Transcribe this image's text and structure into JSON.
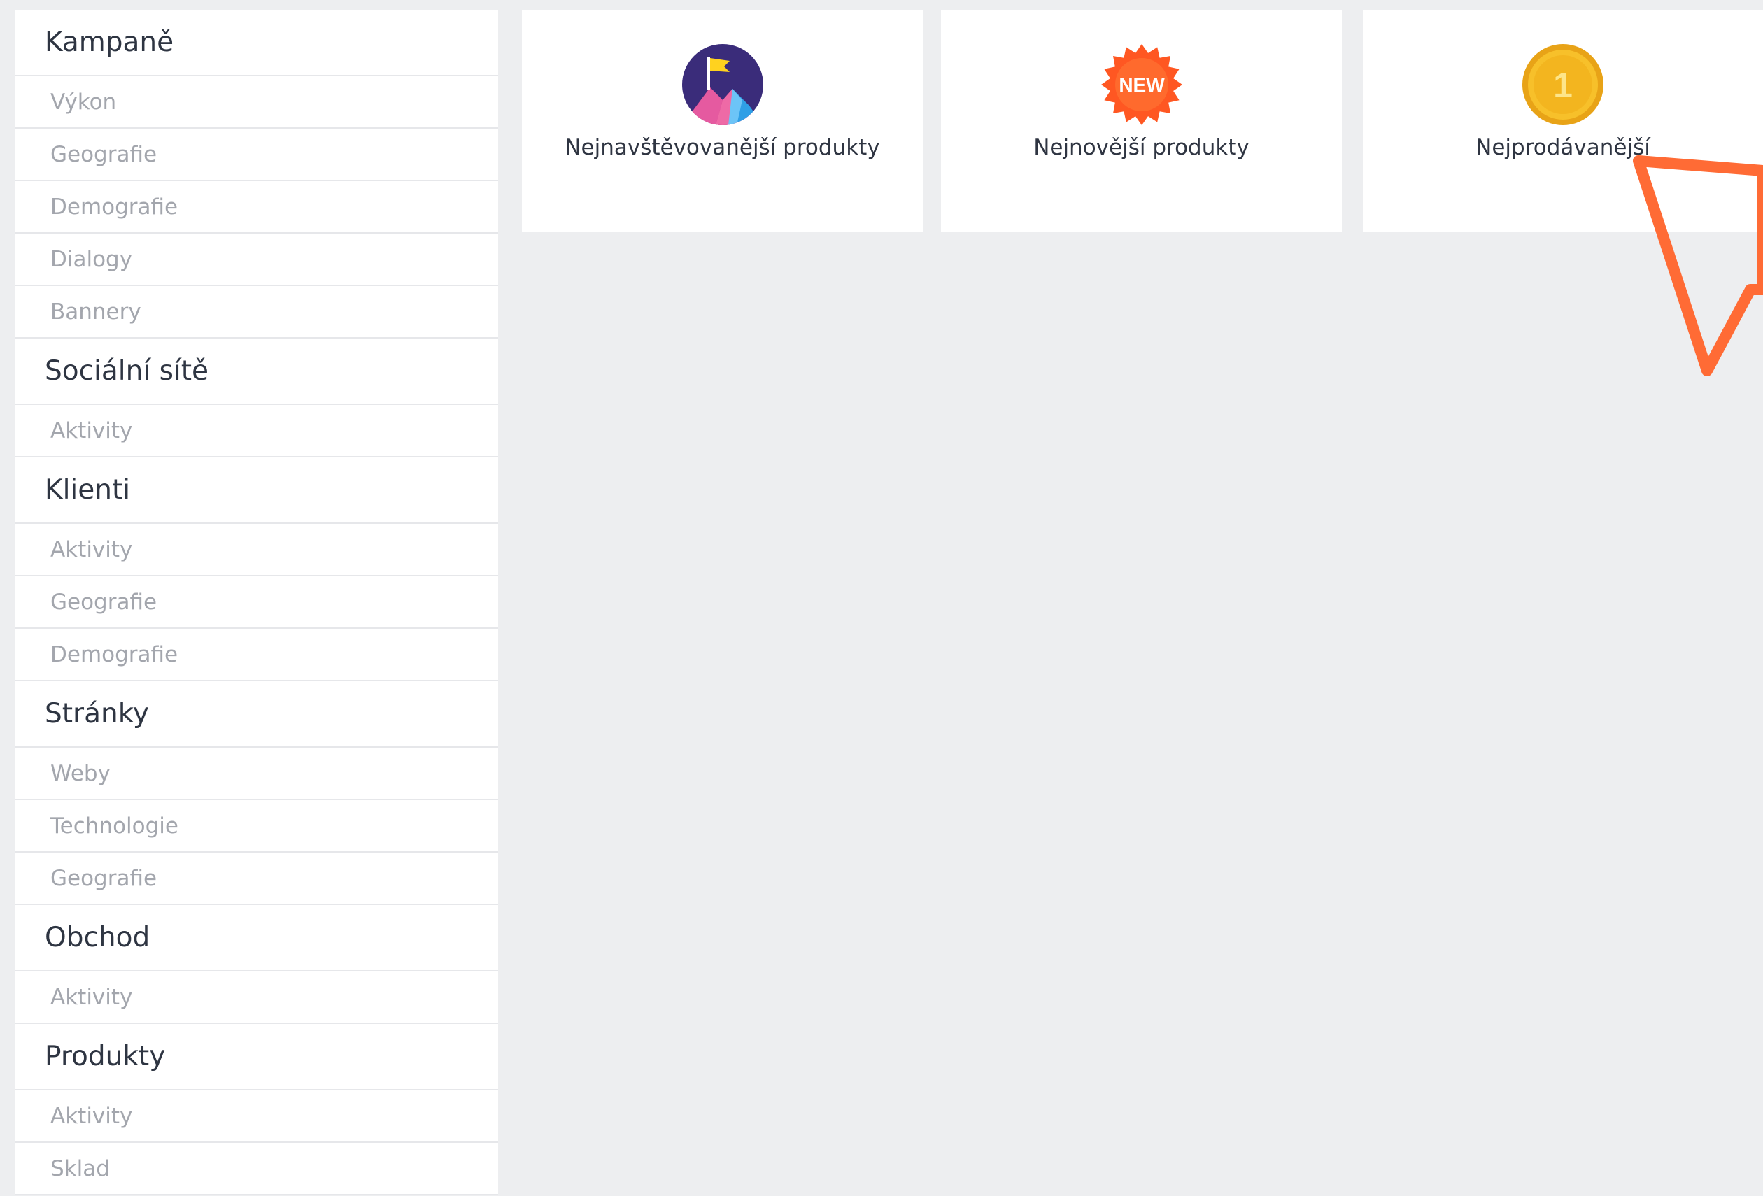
{
  "sidebar": {
    "groups": [
      {
        "label": "Kampaně",
        "items": [
          "Výkon",
          "Geografie",
          "Demografie",
          "Dialogy",
          "Bannery"
        ]
      },
      {
        "label": "Sociální sítě",
        "items": [
          "Aktivity"
        ]
      },
      {
        "label": "Klienti",
        "items": [
          "Aktivity",
          "Geografie",
          "Demografie"
        ]
      },
      {
        "label": "Stránky",
        "items": [
          "Weby",
          "Technologie",
          "Geografie"
        ]
      },
      {
        "label": "Obchod",
        "items": [
          "Aktivity"
        ]
      },
      {
        "label": "Produkty",
        "items": [
          "Aktivity",
          "Sklad"
        ]
      }
    ]
  },
  "cards": [
    {
      "label": "Nejnavštěvovanější produkty",
      "icon": "mountain-flag-icon"
    },
    {
      "label": "Nejnovější produkty",
      "icon": "new-badge-icon",
      "badge_text": "NEW"
    },
    {
      "label": "Nejprodávanější",
      "icon": "gold-medal-icon",
      "badge_text": "1"
    }
  ],
  "colors": {
    "background": "#edeef0",
    "arrow": "#ff6b35",
    "new_badge": "#ff5722",
    "medal": "#f2b21b"
  }
}
